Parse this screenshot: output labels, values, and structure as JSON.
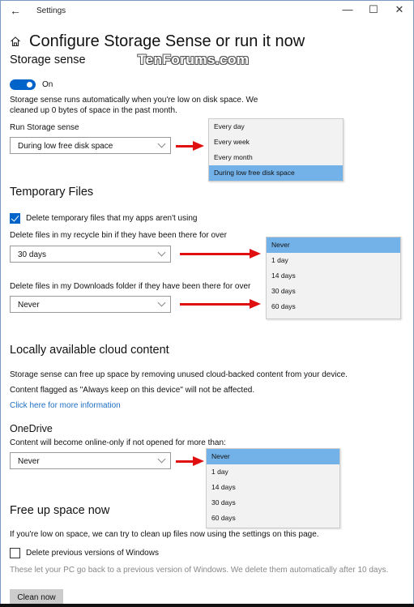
{
  "window": {
    "title": "Settings",
    "back_glyph": "←",
    "minimize_glyph": "—",
    "maximize_glyph": "☐",
    "close_glyph": "✕"
  },
  "page": {
    "title": "Configure Storage Sense or run it now",
    "watermark": "TenForums.com"
  },
  "storage_sense": {
    "heading": "Storage sense",
    "toggle_label": "On",
    "toggle_on": true,
    "description_line1": "Storage sense runs automatically when you're low on disk space. We",
    "description_line2": "cleaned up 0 bytes of space in the past month.",
    "run_label": "Run Storage sense",
    "run_value": "During low free disk space",
    "run_options": [
      "Every day",
      "Every week",
      "Every month",
      "During low free disk space"
    ],
    "run_selected_index": 3
  },
  "temporary_files": {
    "heading": "Temporary Files",
    "delete_temp_label": "Delete temporary files that my apps aren't using",
    "delete_temp_checked": true,
    "recycle_label": "Delete files in my recycle bin if they have been there for over",
    "recycle_value": "30 days",
    "recycle_options": [
      "Never",
      "1 day",
      "14 days",
      "30 days",
      "60 days"
    ],
    "recycle_selected_index": 0,
    "downloads_label": "Delete files in my Downloads folder if they have been there for over",
    "downloads_value": "Never"
  },
  "cloud": {
    "heading": "Locally available cloud content",
    "line1": "Storage sense can free up space by removing unused cloud-backed content from your device.",
    "line2": "Content flagged as \"Always keep on this device\" will not be affected.",
    "link": "Click here for more information"
  },
  "onedrive": {
    "heading": "OneDrive",
    "label": "Content will become online-only if not opened for more than:",
    "value": "Never",
    "options": [
      "Never",
      "1 day",
      "14 days",
      "30 days",
      "60 days"
    ],
    "selected_index": 0
  },
  "free_up": {
    "heading": "Free up space now",
    "description": "If you're low on space, we can try to clean up files now using the settings on this page.",
    "prev_windows_label": "Delete previous versions of Windows",
    "prev_windows_checked": false,
    "prev_windows_note": "These let your PC go back to a previous version of Windows. We delete them automatically after 10 days.",
    "clean_button": "Clean now"
  }
}
